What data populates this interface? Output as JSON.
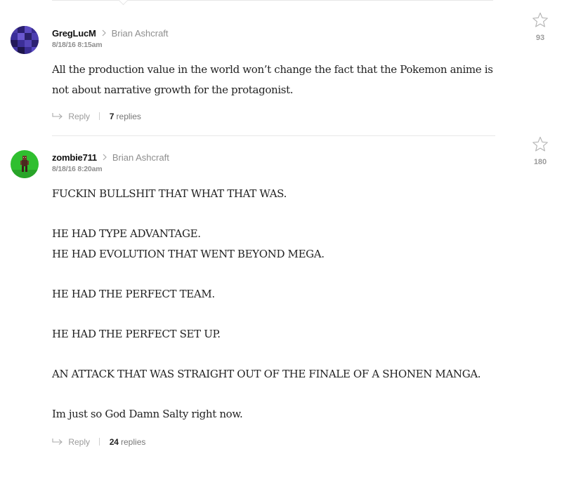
{
  "comments": [
    {
      "author": "GregLucM",
      "reply_to": "Brian Ashcraft",
      "timestamp": "8/18/16 8:15am",
      "paragraphs": [
        "All the production value in the world won’t change the fact that the Pokemon anime is not about narrative growth for the protagonist."
      ],
      "reply_label": "Reply",
      "replies_count": "7",
      "replies_label": "replies",
      "star_count": "93",
      "avatar_icon": "pixelated-purple-avatar"
    },
    {
      "author": "zombie711",
      "reply_to": "Brian Ashcraft",
      "timestamp": "8/18/16 8:20am",
      "paragraphs": [
        "FUCKIN BULLSHIT THAT WHAT THAT WAS.",
        "",
        "HE HAD TYPE ADVANTAGE.",
        "HE HAD EVOLUTION THAT WENT BEYOND MEGA.",
        "",
        "HE HAD THE PERFECT TEAM.",
        "",
        "HE HAD THE PERFECT SET UP.",
        "",
        "AN ATTACK THAT WAS STRAIGHT OUT OF THE FINALE OF A SHONEN MANGA.",
        "",
        "Im just so God Damn Salty right now."
      ],
      "reply_label": "Reply",
      "replies_count": "24",
      "replies_label": "replies",
      "star_count": "180",
      "avatar_icon": "green-zombie-avatar"
    }
  ],
  "icons": {
    "star": "star-outline-icon",
    "reply": "reply-arrow-icon",
    "chevron": "chevron-right-icon"
  },
  "colors": {
    "muted_text": "#8e8e8e",
    "body_text": "#222222",
    "divider": "#e8e8e8",
    "avatar1_purple": "#3b2f8a",
    "avatar2_green": "#2fbf2f"
  }
}
